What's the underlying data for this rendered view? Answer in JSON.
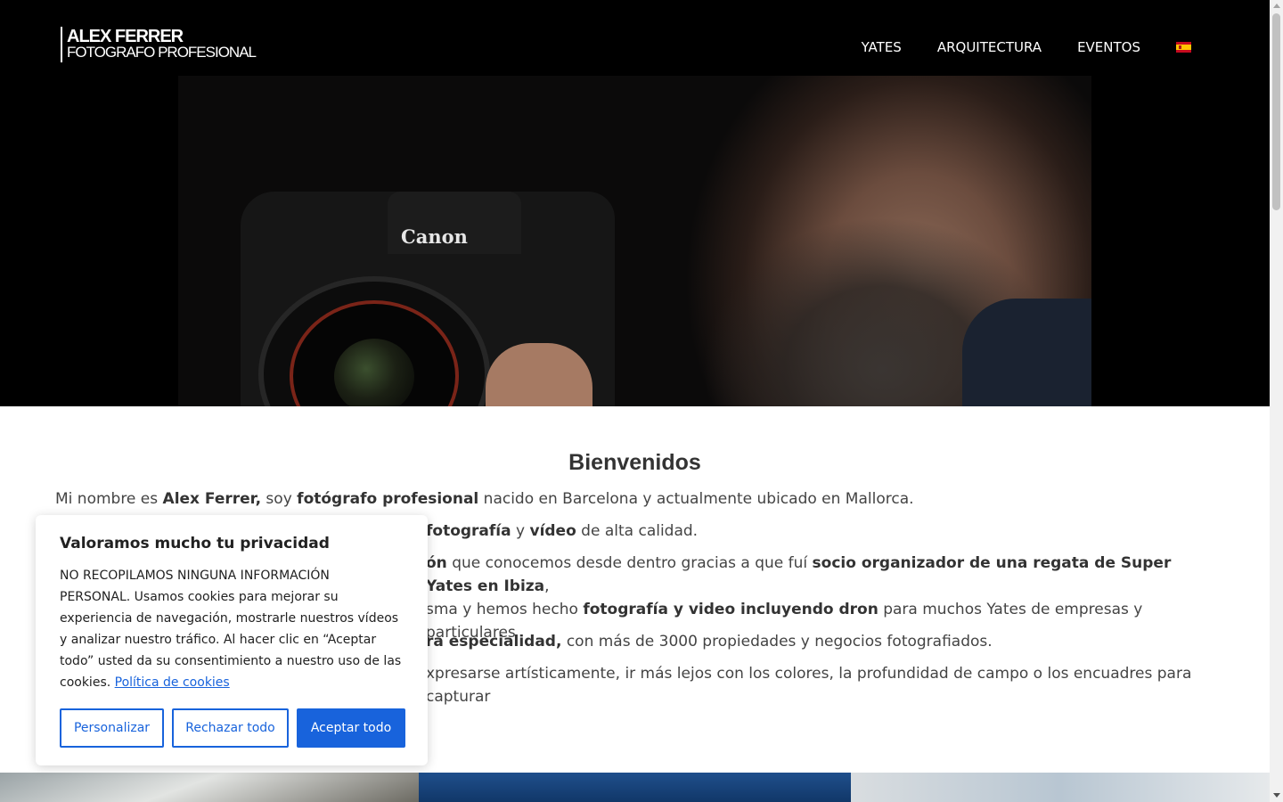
{
  "header": {
    "logo_line1": "ALEX FERRER",
    "logo_line2": "FOTOGRAFO PROFESIONAL",
    "nav": [
      {
        "label": "YATES"
      },
      {
        "label": "ARQUITECTURA"
      },
      {
        "label": "EVENTOS"
      }
    ],
    "language_flag": "spain-flag-icon"
  },
  "hero": {
    "camera_brand": "Canon"
  },
  "content": {
    "title": "Bienvenidos",
    "p1": {
      "t1": "Mi nombre es ",
      "b1": "Alex Ferrer,",
      "t2": " soy ",
      "b2": "fotógrafo profesional",
      "t3": " nacido en Barcelona y actualmente ubicado en Mallorca."
    },
    "p2": {
      "b1": "fotografía",
      "t1": " y ",
      "b2": "vídeo",
      "t2": " de alta calidad."
    },
    "p3": {
      "b1": "ón",
      "t1": " que conocemos desde dentro gracias a que fuí ",
      "b2": "socio organizador de una regata de Super Yates en Ibiza",
      "t2": ",",
      "t3": "sma y hemos hecho ",
      "b3": "fotografía y video incluyendo dron",
      "t4": " para muchos Yates de empresas y particulares"
    },
    "p4": {
      "b1": "ra especialidad,",
      "t1": " con más de 3000 propiedades y negocios fotografiados."
    },
    "p5": {
      "t1": "xpresarse artísticamente, ir más lejos con los colores, la profundidad de campo o los encuadres para capturar"
    }
  },
  "cookie": {
    "title": "Valoramos mucho tu privacidad",
    "text": "NO RECOPILAMOS NINGUNA INFORMACIÓN PERSONAL. Usamos cookies para mejorar su experiencia de navegación, mostrarle nuestros vídeos y analizar nuestro tráfico. Al hacer clic en “Aceptar todo” usted da su consentimiento a nuestro uso de las cookies.",
    "link": "Política de cookies",
    "buttons": {
      "customize": "Personalizar",
      "reject": "Rechazar todo",
      "accept": "Aceptar todo"
    }
  },
  "colors": {
    "accent": "#1863dc",
    "header_bg": "#000000"
  }
}
